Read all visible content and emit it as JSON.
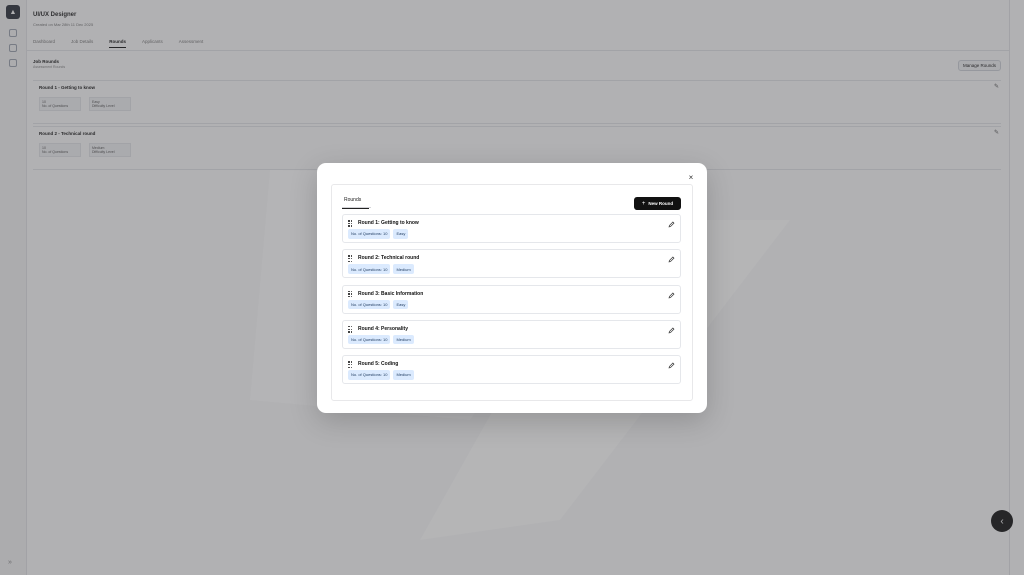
{
  "background": {
    "job_title": "UI/UX Designer",
    "job_subtitle": "Created on Mar 28th  11 Dec 2025",
    "tabs": [
      "Dashboard",
      "Job Details",
      "Rounds",
      "Applicants",
      "Assessment"
    ],
    "active_tab": "Rounds",
    "section_title": "Job Rounds",
    "section_subtitle": "Assessment Rounds",
    "manage_button": "Manage Rounds",
    "cards": [
      {
        "title": "Round 1 - Getting to know",
        "stat1_value": "10",
        "stat1_label": "No. of Questions",
        "stat2_value": "Easy",
        "stat2_label": "Difficulty Level"
      },
      {
        "title": "Round 2 - Technical round",
        "stat1_value": "10",
        "stat1_label": "No. of Questions",
        "stat2_value": "Medium",
        "stat2_label": "Difficulty Level"
      }
    ]
  },
  "modal": {
    "tab_label": "Rounds",
    "new_round_label": "New Round",
    "close_symbol": "×",
    "rounds": [
      {
        "title": "Round 1: Getting to know",
        "questions": "No. of Questions: 10",
        "difficulty": "Easy"
      },
      {
        "title": "Round 2: Technical round",
        "questions": "No. of Questions: 10",
        "difficulty": "Medium"
      },
      {
        "title": "Round 3: Basic Information",
        "questions": "No. of Questions: 10",
        "difficulty": "Easy"
      },
      {
        "title": "Round 4: Personality",
        "questions": "No. of Questions: 10",
        "difficulty": "Medium"
      },
      {
        "title": "Round 5: Coding",
        "questions": "No. of Questions: 10",
        "difficulty": "Medium"
      }
    ]
  },
  "icons": {
    "drag": "drag-handle-icon",
    "edit": "pencil-icon",
    "close": "close-icon",
    "plus": "plus-icon"
  },
  "colors": {
    "badge_bg": "#dbeafe",
    "primary_button": "#111111",
    "overlay": "rgba(70,70,75,0.42)"
  }
}
